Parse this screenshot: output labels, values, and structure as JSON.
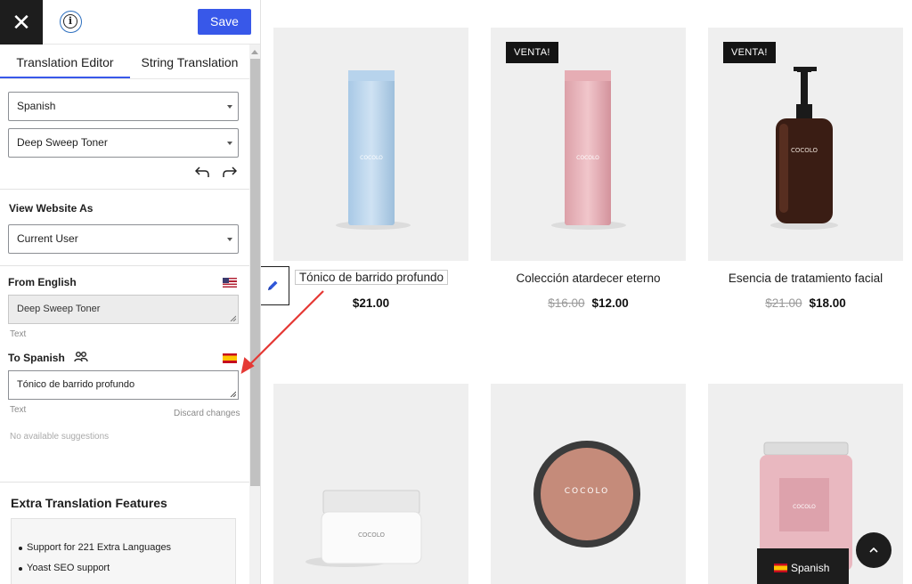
{
  "colors": {
    "accent": "#3858e9",
    "dark": "#1d1d1d",
    "arrow": "#e53935"
  },
  "topbar": {
    "close_icon": "close-icon",
    "close_label": "✕",
    "info_icon": "info-icon",
    "info_label": "i",
    "save_label": "Save"
  },
  "tabs": [
    {
      "label": "Translation Editor",
      "active": true
    },
    {
      "label": "String Translation",
      "active": false
    }
  ],
  "editor": {
    "language_select": "Spanish",
    "string_select": "Deep Sweep Toner",
    "view_as_label": "View Website As",
    "view_as_select": "Current User",
    "from_label": "From English",
    "from_value": "Deep Sweep Toner",
    "from_hint": "Text",
    "to_label": "To Spanish",
    "to_value": "Tónico de barrido profundo",
    "to_hint": "Text",
    "discard_label": "Discard changes",
    "suggestions": "No available suggestions"
  },
  "extra": {
    "title": "Extra Translation Features",
    "items": [
      "Support for 221 Extra Languages",
      "Yoast SEO support"
    ]
  },
  "products": [
    {
      "name": "Tónico de barrido profundo",
      "old_price": "",
      "price": "$21.00",
      "badge": "",
      "shape": "slim-blue"
    },
    {
      "name": "Colección atardecer eterno",
      "old_price": "$16.00",
      "price": "$12.00",
      "badge": "VENTA!",
      "shape": "slim-pink"
    },
    {
      "name": "Esencia de tratamiento facial",
      "old_price": "$21.00",
      "price": "$18.00",
      "badge": "VENTA!",
      "shape": "pump-bottle"
    },
    {
      "name": "",
      "old_price": "",
      "price": "",
      "badge": "",
      "shape": "white-jar"
    },
    {
      "name": "",
      "old_price": "",
      "price": "",
      "badge": "",
      "shape": "round-tin"
    },
    {
      "name": "",
      "old_price": "",
      "price": "",
      "badge": "",
      "shape": "pink-jar"
    }
  ],
  "brand_label": "COCOLO",
  "footer": {
    "language_label": "Spanish",
    "scroll_top_icon": "chevron-up-icon"
  }
}
